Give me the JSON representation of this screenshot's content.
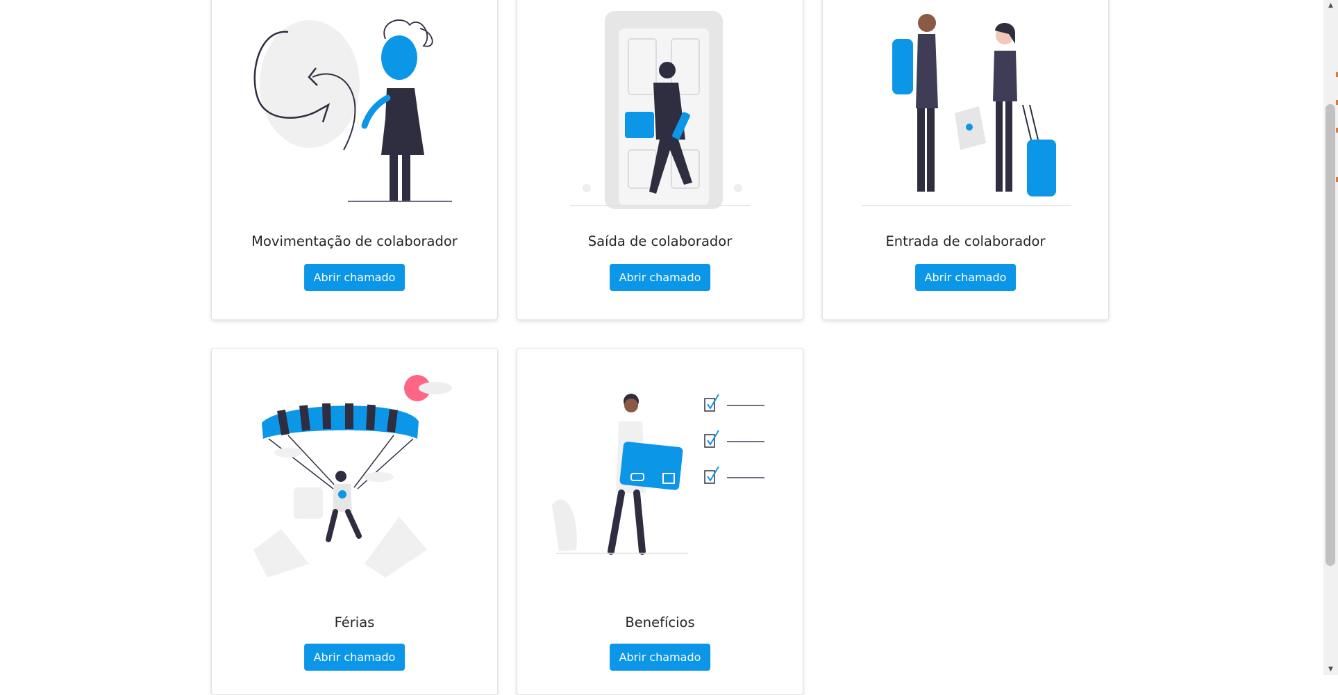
{
  "cards": [
    {
      "title": "Movimentação de colaborador",
      "button": "Abrir chamado",
      "illustration": "person-arrows-illustration"
    },
    {
      "title": "Saída de colaborador",
      "button": "Abrir chamado",
      "illustration": "person-leaving-door-illustration"
    },
    {
      "title": "Entrada de colaborador",
      "button": "Abrir chamado",
      "illustration": "travellers-illustration"
    },
    {
      "title": "Férias",
      "button": "Abrir chamado",
      "illustration": "paraglider-illustration"
    },
    {
      "title": "Benefícios",
      "button": "Abrir chamado",
      "illustration": "card-checklist-illustration"
    }
  ],
  "colors": {
    "accent": "#0b96e8",
    "illustration_blue": "#0b96e8",
    "illustration_dark": "#2f2e41",
    "illustration_light": "#f0f0f0",
    "illustration_pink": "#ff6584"
  }
}
